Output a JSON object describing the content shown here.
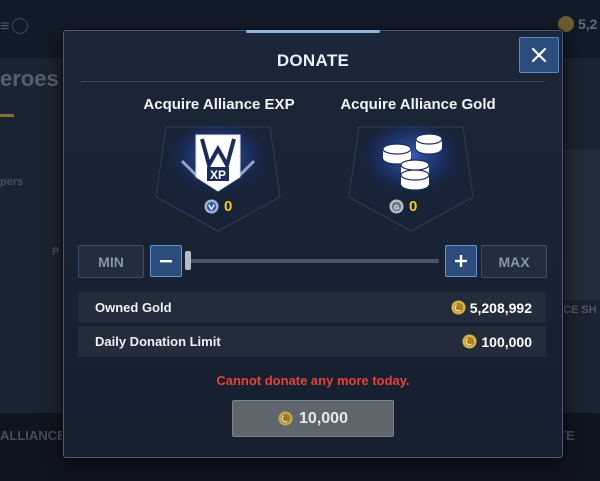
{
  "background": {
    "heroes_text": "eroes",
    "alliance_text": "ALLIANCE",
    "te_text": "TE",
    "shop_text": "ICE SH",
    "top_gold": "5,2",
    "small_text_1": "pers",
    "small_text_2": "P"
  },
  "modal": {
    "title": "DONATE",
    "close_icon": "close-icon"
  },
  "rewards": {
    "exp": {
      "label": "Acquire Alliance EXP",
      "value": "0",
      "icon": "alliance-exp-emblem-icon"
    },
    "gold": {
      "label": "Acquire Alliance Gold",
      "value": "0",
      "icon": "gold-coins-stack-icon"
    }
  },
  "slider": {
    "min_label": "MIN",
    "max_label": "MAX",
    "value_fraction": 0
  },
  "info": {
    "owned_gold_label": "Owned Gold",
    "owned_gold_value": "5,208,992",
    "daily_limit_label": "Daily Donation Limit",
    "daily_limit_value": "100,000"
  },
  "warning": "Cannot donate any more today.",
  "donate_button": {
    "amount": "10,000"
  },
  "colors": {
    "accent_blue": "#2b4c7c",
    "warning_red": "#e2443d",
    "reward_yellow": "#f2cb2c"
  }
}
